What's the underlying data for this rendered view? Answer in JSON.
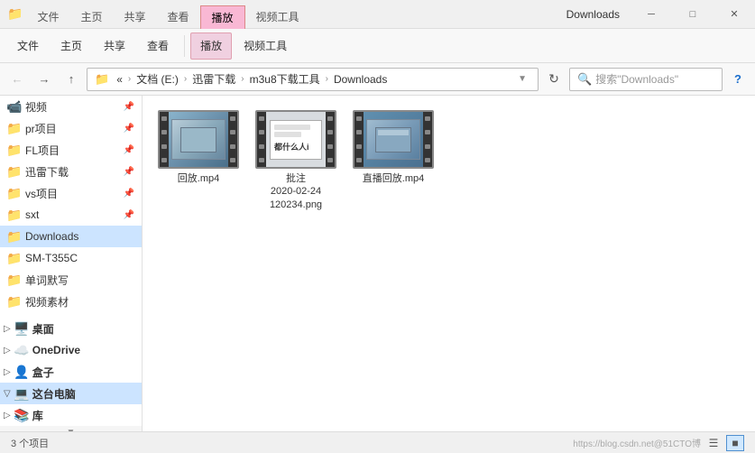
{
  "titlebar": {
    "title": "Downloads",
    "tabs": [
      {
        "label": "文件",
        "active": false
      },
      {
        "label": "主页",
        "active": false
      },
      {
        "label": "共享",
        "active": false
      },
      {
        "label": "查看",
        "active": false
      },
      {
        "label": "播放",
        "active": true,
        "special": true
      },
      {
        "label": "视频工具",
        "active": false,
        "video": true
      }
    ],
    "window_controls": [
      "─",
      "□",
      "✕"
    ]
  },
  "address": {
    "breadcrumbs": [
      "文档 (E:)",
      "迅雷下载",
      "m3u8下载工具",
      "Downloads"
    ],
    "search_placeholder": "搜索\"Downloads\""
  },
  "sidebar": {
    "items": [
      {
        "label": "视频",
        "icon": "📹",
        "pinned": true
      },
      {
        "label": "pr项目",
        "icon": "📁",
        "pinned": true
      },
      {
        "label": "FL项目",
        "icon": "📁",
        "pinned": true
      },
      {
        "label": "迅雷下载",
        "icon": "📁",
        "pinned": true
      },
      {
        "label": "vs项目",
        "icon": "📁",
        "pinned": true
      },
      {
        "label": "sxt",
        "icon": "📁",
        "pinned": true
      },
      {
        "label": "Downloads",
        "icon": "📁",
        "selected": true
      },
      {
        "label": "SM-T355C",
        "icon": "📁"
      },
      {
        "label": "单词默写",
        "icon": "📁"
      },
      {
        "label": "视频素材",
        "icon": "📁"
      }
    ],
    "groups": [
      {
        "label": "桌面",
        "icon": "🖥️"
      },
      {
        "label": "OneDrive",
        "icon": "☁️"
      },
      {
        "label": "盒子",
        "icon": "👤"
      },
      {
        "label": "这台电脑",
        "icon": "💻",
        "selected": true
      },
      {
        "label": "库",
        "icon": "📚"
      }
    ]
  },
  "files": [
    {
      "name": "回放.mp4",
      "type": "video"
    },
    {
      "name": "批注\n2020-02-24\n120234.png",
      "type": "image"
    },
    {
      "name": "直播回放.mp4",
      "type": "video"
    }
  ],
  "statusbar": {
    "count": "3 个项目",
    "watermark": "https://blog.csdn.net@51CTO博",
    "views": [
      "list",
      "grid"
    ]
  }
}
